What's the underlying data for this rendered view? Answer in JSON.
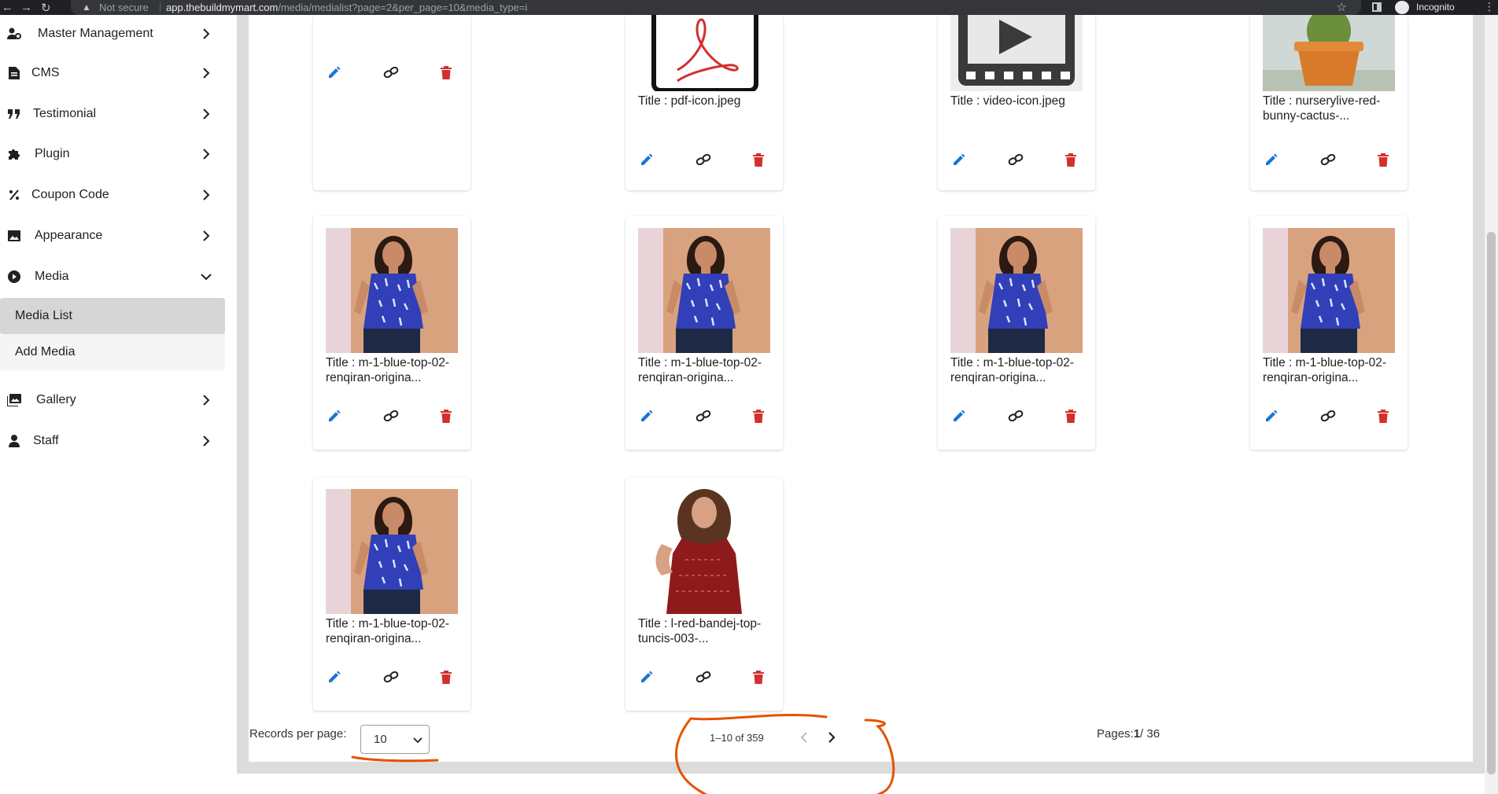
{
  "browser": {
    "not_secure": "Not secure",
    "url_host": "app.thebuildmymart.com",
    "url_path": "/media/medialist?page=2&per_page=10&media_type=i",
    "incognito": "Incognito"
  },
  "sidebar": {
    "items": [
      {
        "label": "Master Management",
        "icon": "user-gear-icon"
      },
      {
        "label": "CMS",
        "icon": "document-icon"
      },
      {
        "label": "Testimonial",
        "icon": "quote-icon"
      },
      {
        "label": "Plugin",
        "icon": "puzzle-icon"
      },
      {
        "label": "Coupon Code",
        "icon": "percent-icon"
      },
      {
        "label": "Appearance",
        "icon": "image-icon"
      },
      {
        "label": "Media",
        "icon": "play-circle-icon",
        "expanded": true
      },
      {
        "label": "Gallery",
        "icon": "photo-library-icon"
      },
      {
        "label": "Staff",
        "icon": "person-icon"
      }
    ],
    "media_sub": [
      {
        "label": "Media List",
        "active": true
      },
      {
        "label": "Add Media",
        "active": false
      }
    ]
  },
  "media": [
    {
      "title": "",
      "thumb": "none"
    },
    {
      "title": "Title : pdf-icon.jpeg",
      "thumb": "pdf"
    },
    {
      "title": "Title : video-icon.jpeg",
      "thumb": "video"
    },
    {
      "title": "Title : nurserylive-red-bunny-cactus-...",
      "thumb": "cactus"
    },
    {
      "title": "Title : m-1-blue-top-02-renqiran-origina...",
      "thumb": "blue-front"
    },
    {
      "title": "Title : m-1-blue-top-02-renqiran-origina...",
      "thumb": "blue-back"
    },
    {
      "title": "Title : m-1-blue-top-02-renqiran-origina...",
      "thumb": "blue-pose"
    },
    {
      "title": "Title : m-1-blue-top-02-renqiran-origina...",
      "thumb": "blue-full"
    },
    {
      "title": "Title : m-1-blue-top-02-renqiran-origina...",
      "thumb": "blue-front"
    },
    {
      "title": "Title : l-red-bandej-top-tuncis-003-...",
      "thumb": "red-top"
    }
  ],
  "pagination": {
    "records_label": "Records per page:",
    "per_page_value": "10",
    "range_text": "1–10 of 359",
    "pages_label": "Pages:",
    "current_page": "1",
    "total_pages": "/ 36"
  },
  "colors": {
    "edit": "#1976d2",
    "delete": "#d32f2f",
    "annotation": "#e65100"
  }
}
